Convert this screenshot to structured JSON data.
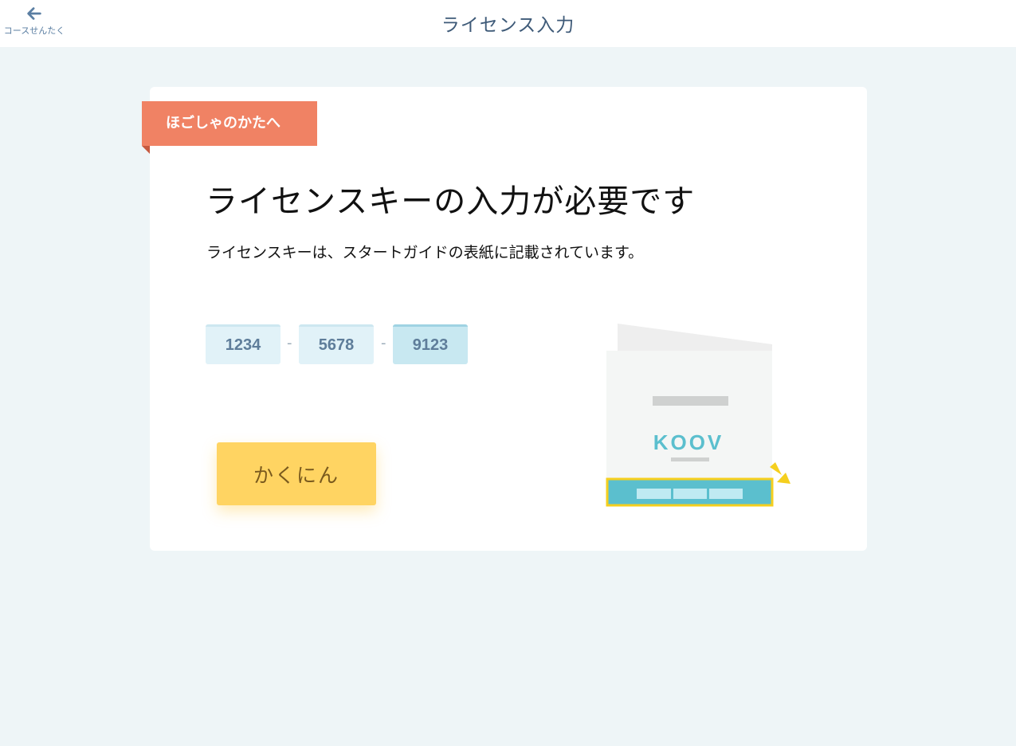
{
  "header": {
    "back_label": "コースせんたく",
    "title": "ライセンス入力"
  },
  "ribbon": {
    "label": "ほごしゃのかたへ"
  },
  "main": {
    "heading": "ライセンスキーの入力が必要です",
    "description": "ライセンスキーは、スタートガイドの表紙に記載されています。"
  },
  "license": {
    "fields": [
      "1234",
      "5678",
      "9123"
    ],
    "separator": "-"
  },
  "confirm_button": {
    "label": "かくにん"
  },
  "illustration": {
    "logo_text": "KOOV"
  },
  "icons": {
    "back": "arrow-left-icon"
  },
  "colors": {
    "ribbon": "#f08264",
    "button": "#ffd462",
    "field": "#e1f2f8",
    "highlight_box": "#5bbfce",
    "highlight_border": "#f5cf1e",
    "header_text": "#3e5a78"
  }
}
